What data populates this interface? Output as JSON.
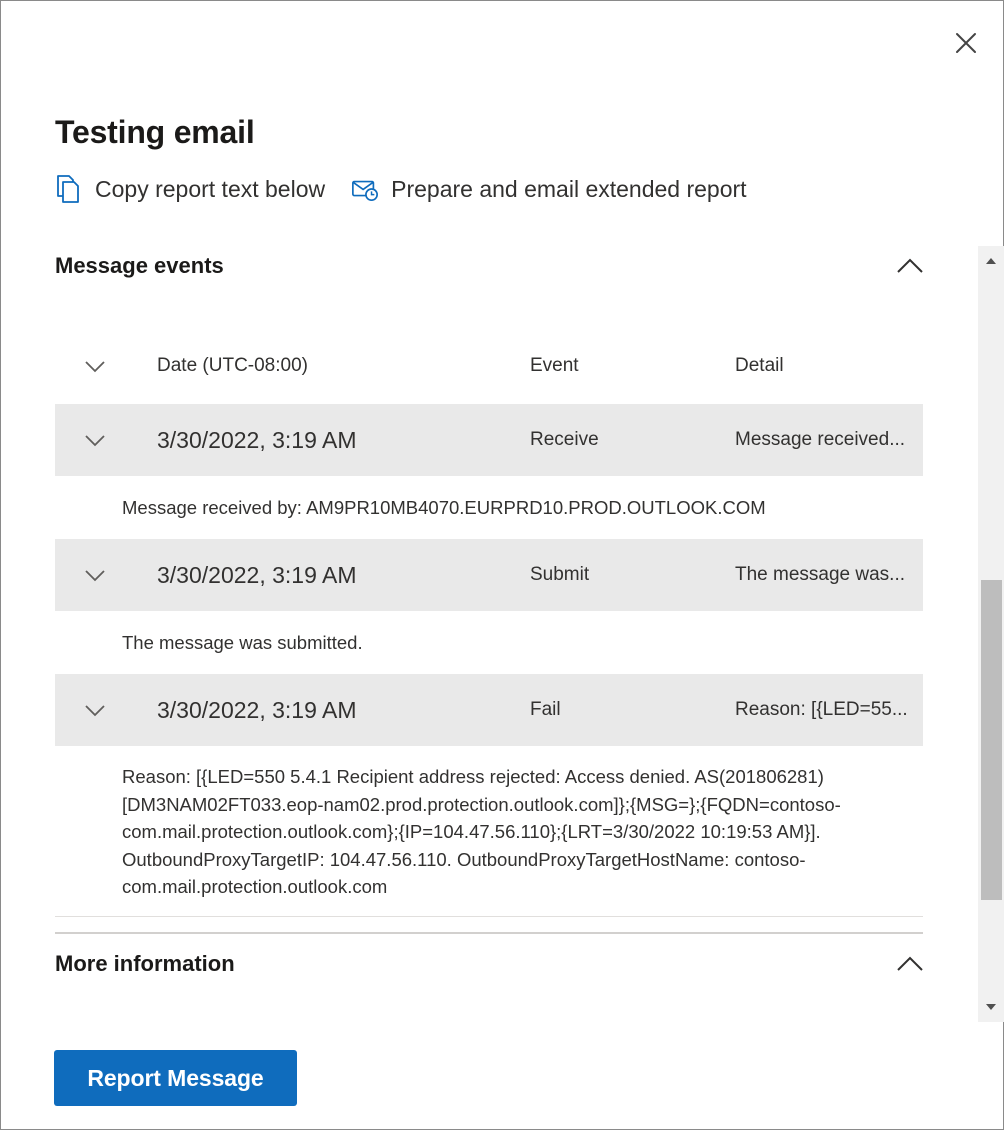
{
  "window": {
    "title": "Testing email"
  },
  "actions": {
    "copy_label": "Copy report text below",
    "email_label": "Prepare and email extended report"
  },
  "message_events": {
    "label": "Message events",
    "expanded": true,
    "columns": {
      "date": "Date (UTC-08:00)",
      "event": "Event",
      "detail": "Detail"
    },
    "rows": [
      {
        "date": "3/30/2022, 3:19 AM",
        "event": "Receive",
        "detail_short": "Message received...",
        "detail_full": "Message received by: AM9PR10MB4070.EURPRD10.PROD.OUTLOOK.COM"
      },
      {
        "date": "3/30/2022, 3:19 AM",
        "event": "Submit",
        "detail_short": "The message was...",
        "detail_full": "The message was submitted."
      },
      {
        "date": "3/30/2022, 3:19 AM",
        "event": "Fail",
        "detail_short": "Reason: [{LED=55...",
        "detail_full_lines": [
          "Reason: [{LED=550 5.4.1 Recipient address rejected: Access denied. AS(201806281)",
          "[DM3NAM02FT033.eop-nam02.prod.protection.outlook.com]};{MSG=};{FQDN=contoso-",
          "com.mail.protection.outlook.com};{IP=104.47.56.110};{LRT=3/30/2022 10:19:53 AM}].",
          "OutboundProxyTargetIP: 104.47.56.110. OutboundProxyTargetHostName: contoso-",
          "com.mail.protection.outlook.com"
        ]
      }
    ]
  },
  "more_information": {
    "label": "More information",
    "expanded": true
  },
  "footer": {
    "report_button": "Report Message"
  },
  "colors": {
    "accent": "#0f6cbd",
    "row_background": "#e9e9e9",
    "text": "#323130",
    "heading": "#1b1a19"
  },
  "icons": {
    "close": "close-icon",
    "copy": "copy-icon",
    "email": "email-report-icon",
    "collapse": "chevron-up-icon",
    "expand": "chevron-down-icon"
  }
}
